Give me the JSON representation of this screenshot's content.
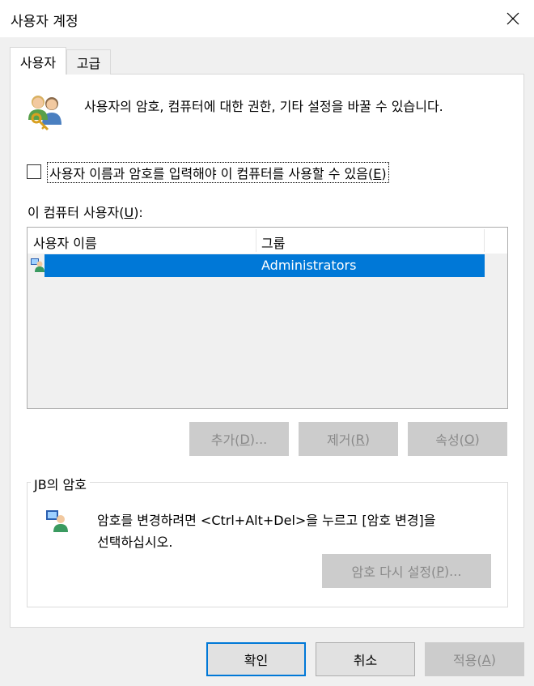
{
  "window": {
    "title": "사용자 계정"
  },
  "tabs": [
    {
      "label": "사용자"
    },
    {
      "label": "고급"
    }
  ],
  "intro": {
    "text": "사용자의 암호, 컴퓨터에 대한 권한, 기타 설정을 바꿀 수 있습니다.",
    "icon": "users-icon"
  },
  "checkbox": {
    "label_main": "사용자 이름과 암호를 입력해야 이 컴퓨터를 사용할 수 있음(",
    "label_key": "E",
    "label_end": ")",
    "checked": false
  },
  "users_section": {
    "label_main": "이 컴퓨터 사용자(",
    "label_key": "U",
    "label_end": "):"
  },
  "user_list": {
    "columns": [
      "사용자 이름",
      "그룹"
    ],
    "rows": [
      {
        "name": "",
        "group": "Administrators",
        "selected": true,
        "icon": "user-icon"
      }
    ]
  },
  "list_buttons": {
    "add": {
      "main": "추가(",
      "key": "D",
      "end": ")..."
    },
    "remove": {
      "main": "제거(",
      "key": "R",
      "end": ")"
    },
    "properties": {
      "main": "속성(",
      "key": "O",
      "end": ")"
    }
  },
  "password_group": {
    "title": "JB의 암호",
    "line1": "암호를 변경하려면 <Ctrl+Alt+Del>을 누르고 [암호 변경]을",
    "line2": "선택하십시오.",
    "reset_button": {
      "main": "암호 다시 설정(",
      "key": "P",
      "end": ")..."
    },
    "icon": "user-key-icon"
  },
  "footer_buttons": {
    "ok": "확인",
    "cancel": "취소",
    "apply": {
      "main": "적용(",
      "key": "A",
      "end": ")"
    }
  },
  "colors": {
    "selection": "#0078d7",
    "dialog_bg": "#f0f0f0",
    "disabled_text": "#8a8a8a"
  }
}
